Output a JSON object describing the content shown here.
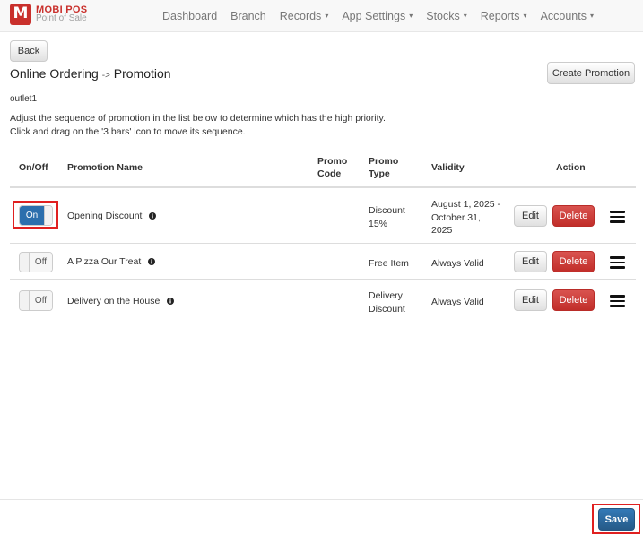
{
  "brand": {
    "title": "MOBI POS",
    "subtitle": "Point of Sale"
  },
  "nav": {
    "items": [
      {
        "label": "Dashboard",
        "dropdown": false
      },
      {
        "label": "Branch",
        "dropdown": false
      },
      {
        "label": "Records",
        "dropdown": true
      },
      {
        "label": "App Settings",
        "dropdown": true
      },
      {
        "label": "Stocks",
        "dropdown": true
      },
      {
        "label": "Reports",
        "dropdown": true
      },
      {
        "label": "Accounts",
        "dropdown": true
      }
    ],
    "caret": "▾"
  },
  "toolbar": {
    "back_label": "Back",
    "create_label": "Create Promotion"
  },
  "page": {
    "title_part1": "Online Ordering",
    "arrow": "->",
    "title_part2": "Promotion",
    "outlet": "outlet1",
    "instruction_line1": "Adjust the sequence of promotion in the list below to determine which has the high priority.",
    "instruction_line2": "Click and drag on the '3 bars' icon to move its sequence."
  },
  "table": {
    "headers": {
      "onoff": "On/Off",
      "name": "Promotion Name",
      "code": [
        "Promo",
        "Code"
      ],
      "type": [
        "Promo",
        "Type"
      ],
      "validity": "Validity",
      "action": "Action"
    },
    "rows": [
      {
        "toggle": "On",
        "enabled": true,
        "name": "Opening Discount",
        "code": "",
        "type": [
          "Discount",
          "15%"
        ],
        "validity": [
          "August 1, 2025 -",
          "October 31,",
          "2025"
        ],
        "edit": "Edit",
        "delete": "Delete"
      },
      {
        "toggle": "Off",
        "enabled": false,
        "name": "A Pizza Our Treat",
        "code": "",
        "type": [
          "Free Item"
        ],
        "validity": [
          "Always Valid"
        ],
        "edit": "Edit",
        "delete": "Delete"
      },
      {
        "toggle": "Off",
        "enabled": false,
        "name": "Delivery on the House",
        "code": "",
        "type": [
          "Delivery",
          "Discount"
        ],
        "validity": [
          "Always Valid"
        ],
        "edit": "Edit",
        "delete": "Delete"
      }
    ]
  },
  "footer": {
    "save_label": "Save"
  },
  "colors": {
    "brand": "#c9302c",
    "primary": "#2c6fad",
    "danger": "#d9534f",
    "highlight": "#e02020"
  }
}
